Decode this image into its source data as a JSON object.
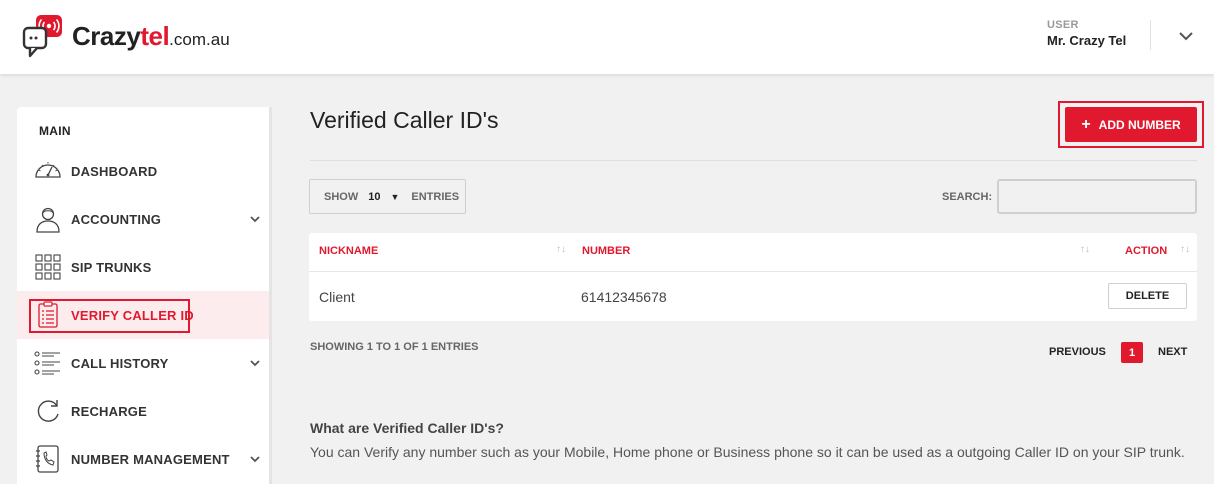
{
  "brand": {
    "name_part1": "Crazy",
    "name_part2": "tel",
    "domain": ".com.au",
    "accent": "#e0192e"
  },
  "user": {
    "label": "USER",
    "name": "Mr. Crazy Tel",
    "menu_icon": "chevron-down-icon"
  },
  "sidebar": {
    "section": "MAIN",
    "items": [
      {
        "label": "DASHBOARD",
        "icon": "speedometer-icon",
        "has_children": false,
        "active": false
      },
      {
        "label": "ACCOUNTING",
        "icon": "user-icon",
        "has_children": true,
        "active": false
      },
      {
        "label": "SIP TRUNKS",
        "icon": "grid-icon",
        "has_children": false,
        "active": false
      },
      {
        "label": "VERIFY CALLER ID",
        "icon": "clipboard-icon",
        "has_children": false,
        "active": true
      },
      {
        "label": "CALL HISTORY",
        "icon": "list-icon",
        "has_children": true,
        "active": false
      },
      {
        "label": "RECHARGE",
        "icon": "refresh-icon",
        "has_children": false,
        "active": false
      },
      {
        "label": "NUMBER MANAGEMENT",
        "icon": "phone-book-icon",
        "has_children": true,
        "active": false
      }
    ]
  },
  "main": {
    "title": "Verified Caller ID's",
    "add_button": "ADD NUMBER",
    "length": {
      "show": "SHOW",
      "value": "10",
      "entries": "ENTRIES"
    },
    "search": {
      "label": "SEARCH:",
      "value": "",
      "placeholder": ""
    },
    "table": {
      "columns": [
        "NICKNAME",
        "NUMBER",
        "ACTION"
      ],
      "rows": [
        {
          "nickname": "Client",
          "number": "61412345678",
          "action": "DELETE"
        }
      ]
    },
    "showing": "SHOWING 1 TO 1 OF 1 ENTRIES",
    "pagination": {
      "previous": "PREVIOUS",
      "current": "1",
      "next": "NEXT"
    },
    "info": {
      "heading": "What are Verified Caller ID's?",
      "body": "You can Verify any number such as your Mobile, Home phone or Business phone so it can be used as a outgoing Caller ID on your SIP trunk."
    }
  }
}
